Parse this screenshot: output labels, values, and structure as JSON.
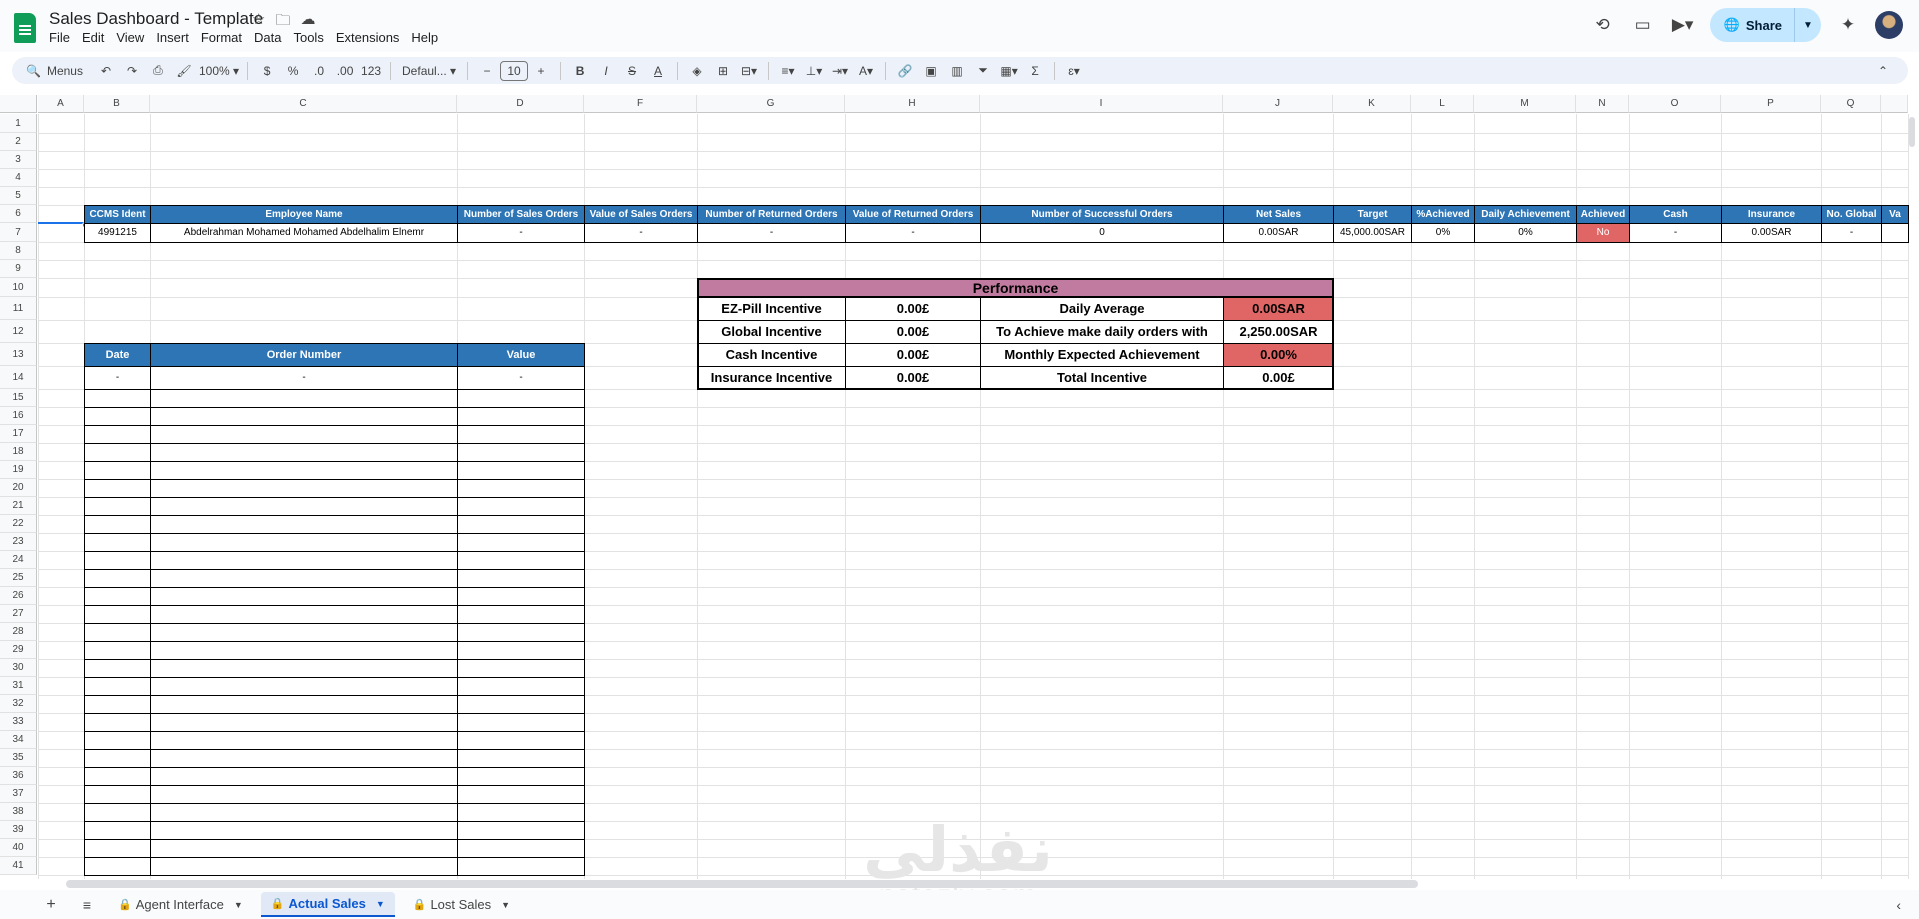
{
  "app": {
    "title": "Sales Dashboard - Template",
    "menus": [
      "File",
      "Edit",
      "View",
      "Insert",
      "Format",
      "Data",
      "Tools",
      "Extensions",
      "Help"
    ],
    "share_label": "Share"
  },
  "toolbar": {
    "menus_label": "Menus",
    "zoom": "100%",
    "currency": "$",
    "percent": "%",
    "dec_decrease": ".0",
    "dec_increase": ".00",
    "number_format": "123",
    "font": "Defaul...",
    "font_size": "10"
  },
  "grid": {
    "columns": [
      "A",
      "B",
      "C",
      "D",
      "F",
      "G",
      "H",
      "I",
      "J",
      "K",
      "L",
      "M",
      "N",
      "O",
      "P",
      "Q"
    ],
    "rows": [
      "1",
      "2",
      "3",
      "4",
      "5",
      "6",
      "7",
      "8",
      "9",
      "10",
      "11",
      "12",
      "13",
      "14",
      "15",
      "16",
      "17",
      "18",
      "19",
      "20",
      "21",
      "22",
      "23",
      "24",
      "25",
      "26",
      "27",
      "28",
      "29",
      "30",
      "31",
      "32",
      "33",
      "34",
      "35",
      "36",
      "37",
      "38",
      "39",
      "40",
      "41"
    ]
  },
  "employee_table": {
    "headers": [
      "CCMS Ident",
      "Employee Name",
      "Number of Sales Orders",
      "Value of Sales Orders",
      "Number of Returned Orders",
      "Value of Returned Orders",
      "Number of Successful Orders",
      "Net Sales",
      "Target",
      "%Achieved",
      "Daily Achievement",
      "Achieved",
      "Cash",
      "Insurance",
      "No. Global",
      "Va"
    ],
    "row": [
      "4991215",
      "Abdelrahman Mohamed Mohamed Abdelhalim Elnemr",
      "-",
      "-",
      "-",
      "-",
      "0",
      "0.00SAR",
      "45,000.00SAR",
      "0%",
      "0%",
      "No",
      "-",
      "0.00SAR",
      "-",
      ""
    ]
  },
  "performance": {
    "title": "Performance",
    "rows": [
      {
        "label": "EZ-Pill Incentive",
        "value": "0.00£",
        "label2": "Daily Average",
        "value2": "0.00SAR"
      },
      {
        "label": "Global Incentive",
        "value": "0.00£",
        "label2": "To Achieve make daily orders with",
        "value2": "2,250.00SAR"
      },
      {
        "label": "Cash Incentive",
        "value": "0.00£",
        "label2": "Monthly Expected Achievement",
        "value2": "0.00%"
      },
      {
        "label": "Insurance Incentive",
        "value": "0.00£",
        "label2": "Total Incentive",
        "value2": "0.00£"
      }
    ]
  },
  "orders_table": {
    "headers": [
      "Date",
      "Order Number",
      "Value"
    ],
    "first_row": [
      "-",
      "-",
      "-"
    ]
  },
  "sheets": {
    "tabs": [
      "Agent Interface",
      "Actual Sales",
      "Lost Sales"
    ],
    "active": "Actual Sales"
  },
  "watermark": {
    "arabic": "نفذلي",
    "latin": "nafezly.com"
  },
  "colors": {
    "header_blue": "#2e75b6",
    "performance_pink": "#c27ba0",
    "alert_red": "#e06666"
  }
}
